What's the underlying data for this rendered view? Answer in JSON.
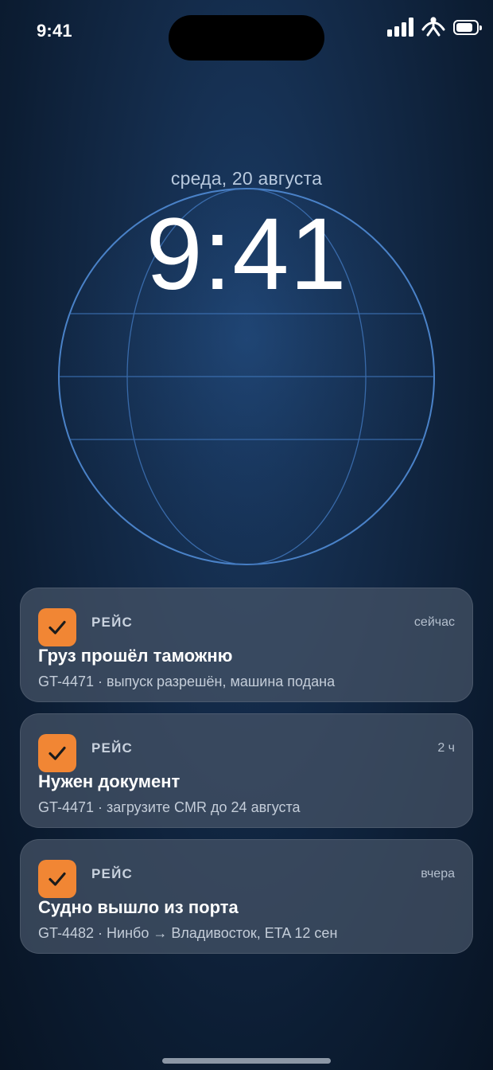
{
  "status_bar": {
    "time": "9:41",
    "icons": [
      "signal-icon",
      "accessibility-icon",
      "battery-icon"
    ]
  },
  "lock_screen": {
    "date": "среда, 20 августа",
    "clock": "9:41"
  },
  "colors": {
    "app_icon": "#f18634",
    "globe_line": "#3f74b8"
  },
  "notifications": [
    {
      "app": "РЕЙС",
      "time": "сейчас",
      "title": "Груз прошёл таможню",
      "body": "GT-4471 · выпуск разрешён, машина подана",
      "icon": "checkmark-icon"
    },
    {
      "app": "РЕЙС",
      "time": "2 ч",
      "title": "Нужен документ",
      "body": "GT-4471 · загрузите CMR до 24 августа",
      "icon": "checkmark-icon"
    },
    {
      "app": "РЕЙС",
      "time": "вчера",
      "title": "Судно вышло из порта",
      "body": "GT-4482 · Нинбо → Владивосток, ETA 12 сен",
      "icon": "checkmark-icon"
    }
  ]
}
